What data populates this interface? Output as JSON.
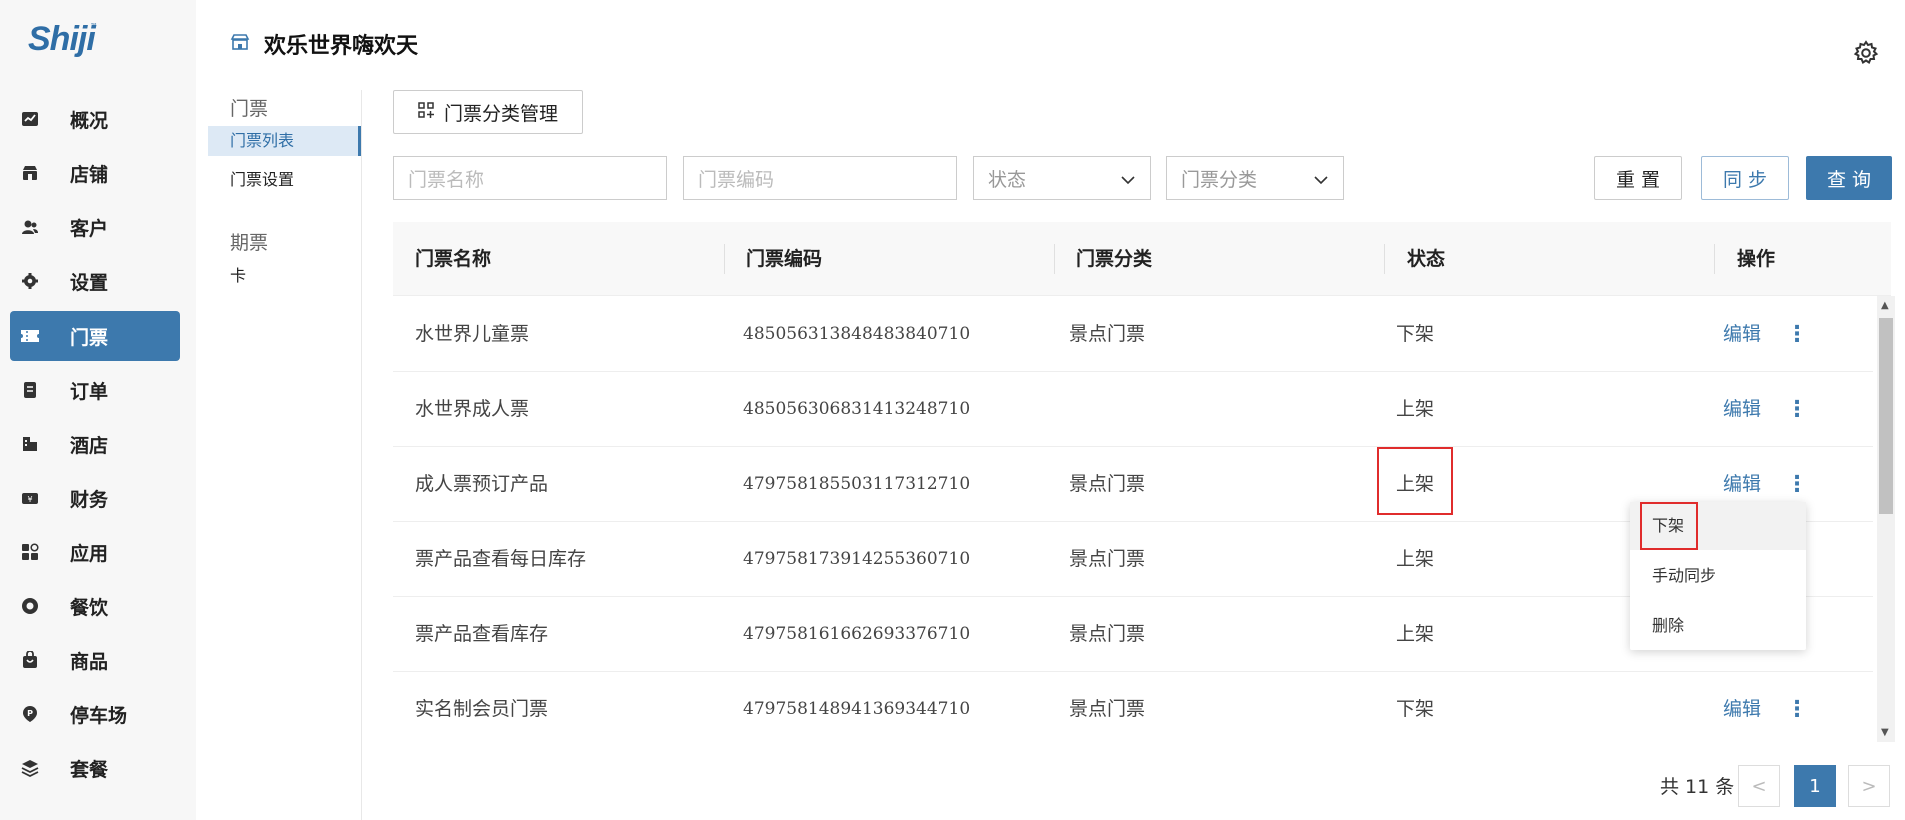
{
  "brand": {
    "logo_text": "Shiji",
    "tm": "™"
  },
  "header": {
    "title": "欢乐世界嗨欢天"
  },
  "nav": {
    "items": [
      {
        "label": "概况",
        "icon": "chart-icon"
      },
      {
        "label": "店铺",
        "icon": "store-icon"
      },
      {
        "label": "客户",
        "icon": "users-icon"
      },
      {
        "label": "设置",
        "icon": "gear-icon"
      },
      {
        "label": "门票",
        "icon": "ticket-icon",
        "active": true
      },
      {
        "label": "订单",
        "icon": "order-icon"
      },
      {
        "label": "酒店",
        "icon": "hotel-icon"
      },
      {
        "label": "财务",
        "icon": "finance-icon"
      },
      {
        "label": "应用",
        "icon": "apps-icon"
      },
      {
        "label": "餐饮",
        "icon": "dining-icon"
      },
      {
        "label": "商品",
        "icon": "goods-icon"
      },
      {
        "label": "停车场",
        "icon": "parking-icon"
      },
      {
        "label": "套餐",
        "icon": "package-icon"
      }
    ]
  },
  "subnav": {
    "group1": "门票",
    "items1": [
      "门票列表",
      "门票设置"
    ],
    "group2": "期票",
    "items2": [
      "卡"
    ]
  },
  "toolbar": {
    "category_manage": "门票分类管理"
  },
  "filters": {
    "name_placeholder": "门票名称",
    "code_placeholder": "门票编码",
    "status_placeholder": "状态",
    "category_placeholder": "门票分类",
    "reset": "重 置",
    "sync": "同 步",
    "query": "查 询"
  },
  "table": {
    "columns": [
      "门票名称",
      "门票编码",
      "门票分类",
      "状态",
      "操作"
    ],
    "rows": [
      {
        "name": "水世界儿童票",
        "code": "485056313848483840710",
        "category": "景点门票",
        "status": "下架",
        "edit": "编辑",
        "more": "⋮"
      },
      {
        "name": "水世界成人票",
        "code": "485056306831413248710",
        "category": "",
        "status": "上架",
        "edit": "编辑",
        "more": "⋮"
      },
      {
        "name": "成人票预订产品",
        "code": "479758185503117312710",
        "category": "景点门票",
        "status": "上架",
        "edit": "编辑",
        "more": "⋮"
      },
      {
        "name": "票产品查看每日库存",
        "code": "479758173914255360710",
        "category": "景点门票",
        "status": "上架",
        "edit": "",
        "more": ""
      },
      {
        "name": "票产品查看库存",
        "code": "479758161662693376710",
        "category": "景点门票",
        "status": "上架",
        "edit": "",
        "more": ""
      },
      {
        "name": "实名制会员门票",
        "code": "479758148941369344710",
        "category": "景点门票",
        "status": "下架",
        "edit": "编辑",
        "more": "⋮"
      }
    ]
  },
  "dropdown": {
    "items": [
      "下架",
      "手动同步",
      "删除"
    ]
  },
  "pagination": {
    "total": "共 11 条",
    "prev": "<",
    "current": "1",
    "next": ">"
  },
  "colors": {
    "primary": "#3d79ad",
    "highlight": "#e02c2c"
  }
}
